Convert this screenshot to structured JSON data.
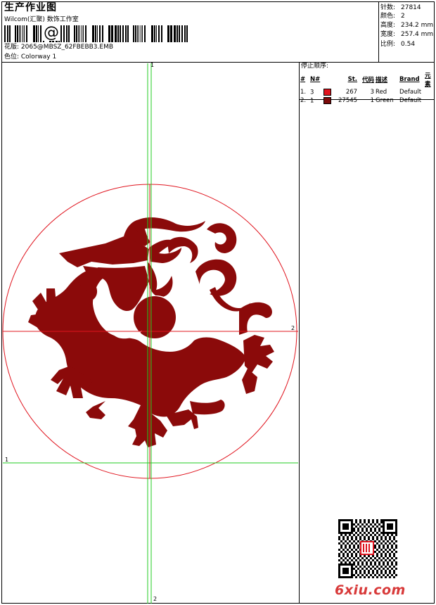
{
  "header": {
    "title": "生产作业图",
    "company": "Wilcom(汇聚) 数饰工作室",
    "barcode_symbol": "@",
    "design_label": "花版: 2065@MBSZ_62FBEBB3.EMB",
    "colorway_label": "色位: Colorway 1"
  },
  "stats": [
    {
      "label": "针数:",
      "value": "27814"
    },
    {
      "label": "颜色:",
      "value": "2"
    },
    {
      "label": "高度:",
      "value": "234.2 mm"
    },
    {
      "label": "宽度:",
      "value": "257.4 mm"
    },
    {
      "label": "比例:",
      "value": "0.54"
    }
  ],
  "stop_sequence": {
    "title": "停止顺序:",
    "headers": [
      "#",
      "N#",
      "St.",
      "代码",
      "描述",
      "Brand",
      "元素"
    ],
    "rows": [
      {
        "index": "1.",
        "needle": "3",
        "color": "#e0141e",
        "stitches": "267",
        "code": "3",
        "description": "Red",
        "brand": "Default",
        "element": ""
      },
      {
        "index": "2.",
        "needle": "1",
        "color": "#7c0a0a",
        "stitches": "27545",
        "code": "1",
        "description": "Green",
        "brand": "Default",
        "element": ""
      }
    ]
  },
  "axes": {
    "h_top": "2",
    "h_bottom": "1",
    "v_top": "1",
    "v_bottom": "2"
  },
  "colors": {
    "embroidery": "#8b0a0a",
    "outline": "#e0141e",
    "guide": "#22cc22"
  },
  "icons": [
    "dragon-design",
    "qr-code",
    "seal-stamp"
  ],
  "watermark": "6xiu.com"
}
